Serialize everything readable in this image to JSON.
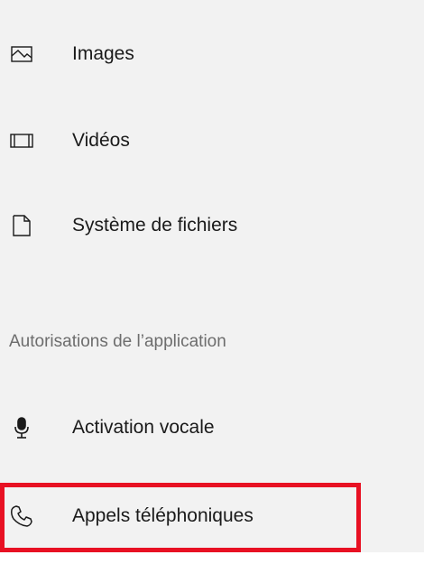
{
  "nav": {
    "items": [
      {
        "label": "Images",
        "icon": "image-icon"
      },
      {
        "label": "Vidéos",
        "icon": "video-icon"
      },
      {
        "label": "Système de fichiers",
        "icon": "file-icon"
      }
    ]
  },
  "section": {
    "header": "Autorisations de l’application",
    "items": [
      {
        "label": "Activation vocale",
        "icon": "microphone-icon"
      },
      {
        "label": "Appels téléphoniques",
        "icon": "phone-icon"
      }
    ]
  },
  "highlight": {
    "color": "#e81123"
  }
}
